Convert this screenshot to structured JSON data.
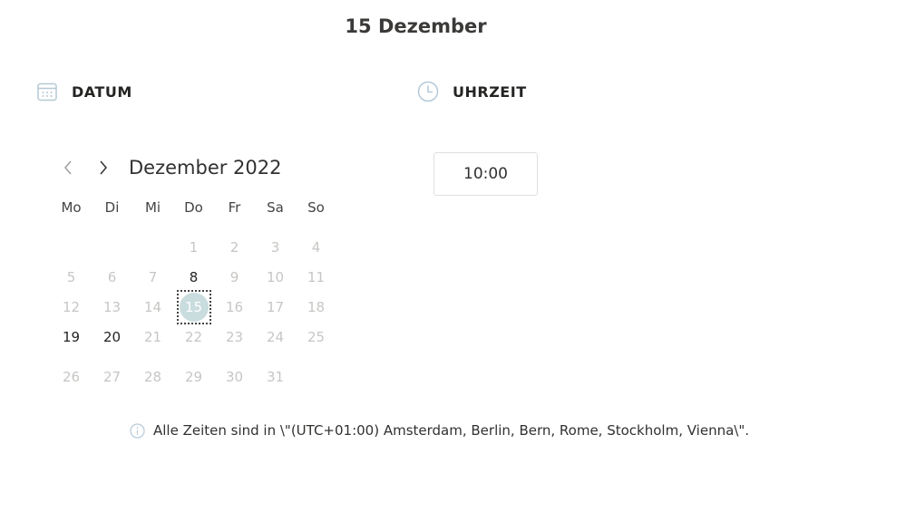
{
  "page_title": "15 Dezember",
  "date_section": {
    "label": "DATUM",
    "icon": "calendar-icon"
  },
  "time_section": {
    "label": "UHRZEIT",
    "icon": "clock-icon"
  },
  "calendar": {
    "month_label": "Dezember 2022",
    "prev_icon": "chevron-left-icon",
    "next_icon": "chevron-right-icon",
    "weekdays": [
      "Mo",
      "Di",
      "Mi",
      "Do",
      "Fr",
      "Sa",
      "So"
    ],
    "weeks": [
      [
        "",
        "",
        "",
        "1",
        "2",
        "3",
        "4"
      ],
      [
        "5",
        "6",
        "7",
        "8",
        "9",
        "10",
        "11"
      ],
      [
        "12",
        "13",
        "14",
        "15",
        "16",
        "17",
        "18"
      ],
      [
        "19",
        "20",
        "21",
        "22",
        "23",
        "24",
        "25"
      ],
      [
        "26",
        "27",
        "28",
        "29",
        "30",
        "31",
        ""
      ]
    ],
    "available_days": [
      "8",
      "15",
      "19",
      "20"
    ],
    "selected_day": "15"
  },
  "time": {
    "value": "10:00"
  },
  "timezone_info": {
    "icon": "info-icon",
    "text": "Alle Zeiten sind in \\\"(UTC+01:00) Amsterdam, Berlin, Bern, Rome, Stockholm, Vienna\\\"."
  },
  "colors": {
    "selected_fill": "#c9dcde",
    "disabled_text": "#c8c6c4",
    "icon_stroke": "#b4c9d6"
  }
}
